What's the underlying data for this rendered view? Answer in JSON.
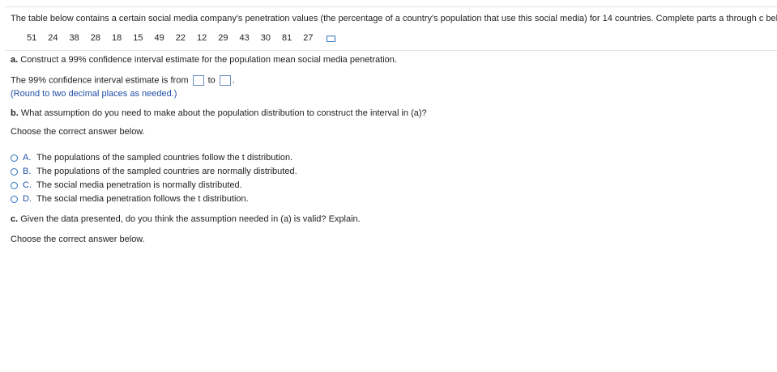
{
  "intro_text": "The table below contains a certain social media company's penetration values (the percentage of a country's population that use this social media) for 14 countries. Complete parts a through c below.",
  "data_values": [
    "51",
    "24",
    "38",
    "28",
    "18",
    "15",
    "49",
    "22",
    "12",
    "29",
    "43",
    "30",
    "81",
    "27"
  ],
  "data_icon": "data-table-icon",
  "part_a": {
    "prompt_label": "a.",
    "prompt_text": " Construct a 99% confidence interval estimate for the population mean social media penetration.",
    "answer_prefix": "The 99% confidence interval estimate is from",
    "answer_middle": "to",
    "answer_suffix": ".",
    "hint": "(Round to two decimal places as needed.)"
  },
  "part_b": {
    "prompt_label": "b.",
    "prompt_text": " What assumption do you need to make about the population distribution to construct the interval in (a)?",
    "choose_text": "Choose the correct answer below.",
    "options": [
      {
        "letter": "A.",
        "text": "The populations of the sampled countries follow the t distribution."
      },
      {
        "letter": "B.",
        "text": "The populations of the sampled countries are normally distributed."
      },
      {
        "letter": "C.",
        "text": "The social media penetration is normally distributed."
      },
      {
        "letter": "D.",
        "text": "The social media penetration follows the t distribution."
      }
    ]
  },
  "part_c": {
    "prompt_label": "c.",
    "prompt_text": " Given the data presented, do you think the assumption needed in (a) is valid? Explain.",
    "choose_text": "Choose the correct answer below."
  }
}
